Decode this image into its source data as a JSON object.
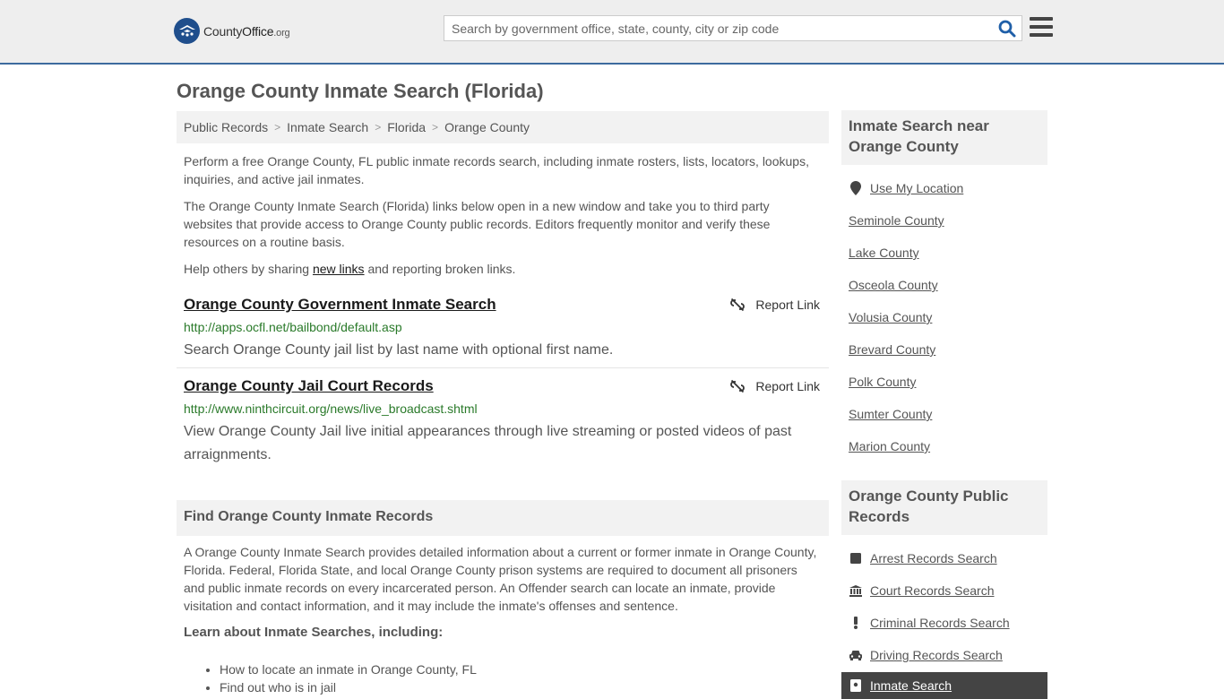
{
  "header": {
    "logo_text_1": "County",
    "logo_text_2": "Office",
    "logo_text_3": ".org",
    "search_placeholder": "Search by government office, state, county, city or zip code"
  },
  "page_title": "Orange County Inmate Search (Florida)",
  "breadcrumb": [
    "Public Records",
    "Inmate Search",
    "Florida",
    "Orange County"
  ],
  "intro": {
    "p1": "Perform a free Orange County, FL public inmate records search, including inmate rosters, lists, locators, lookups, inquiries, and active jail inmates.",
    "p2": "The Orange County Inmate Search (Florida) links below open in a new window and take you to third party websites that provide access to Orange County public records. Editors frequently monitor and verify these resources on a routine basis.",
    "p3_before": "Help others by sharing ",
    "p3_link": "new links",
    "p3_after": " and reporting broken links."
  },
  "results": [
    {
      "title": "Orange County Government Inmate Search",
      "url": "http://apps.ocfl.net/bailbond/default.asp",
      "desc": "Search Orange County jail list by last name with optional first name.",
      "report": "Report Link"
    },
    {
      "title": "Orange County Jail Court Records",
      "url": "http://www.ninthcircuit.org/news/live_broadcast.shtml",
      "desc": "View Orange County Jail live initial appearances through live streaming or posted videos of past arraignments.",
      "report": "Report Link"
    }
  ],
  "find_section": {
    "heading": "Find Orange County Inmate Records",
    "body": "A Orange County Inmate Search provides detailed information about a current or former inmate in Orange County, Florida. Federal, Florida State, and local Orange County prison systems are required to document all prisoners and public inmate records on every incarcerated person. An Offender search can locate an inmate, provide visitation and contact information, and it may include the inmate's offenses and sentence.",
    "learn": "Learn about Inmate Searches, including:",
    "bullets": [
      "How to locate an inmate in Orange County, FL",
      "Find out who is in jail"
    ]
  },
  "sidebar": {
    "nearby_heading": "Inmate Search near Orange County",
    "use_location": "Use My Location",
    "nearby": [
      "Seminole County",
      "Lake County",
      "Osceola County",
      "Volusia County",
      "Brevard County",
      "Polk County",
      "Sumter County",
      "Marion County"
    ],
    "records_heading": "Orange County Public Records",
    "records": [
      {
        "label": "Arrest Records Search",
        "icon": "square-icon"
      },
      {
        "label": "Court Records Search",
        "icon": "courthouse-icon"
      },
      {
        "label": "Criminal Records Search",
        "icon": "exclamation-icon"
      },
      {
        "label": "Driving Records Search",
        "icon": "car-icon"
      }
    ],
    "active": {
      "label": "Inmate Search",
      "icon": "id-badge-icon"
    }
  },
  "colors": {
    "accent": "#3d6b9e",
    "url_green": "#2a7a2a",
    "active_bg": "#444444"
  }
}
